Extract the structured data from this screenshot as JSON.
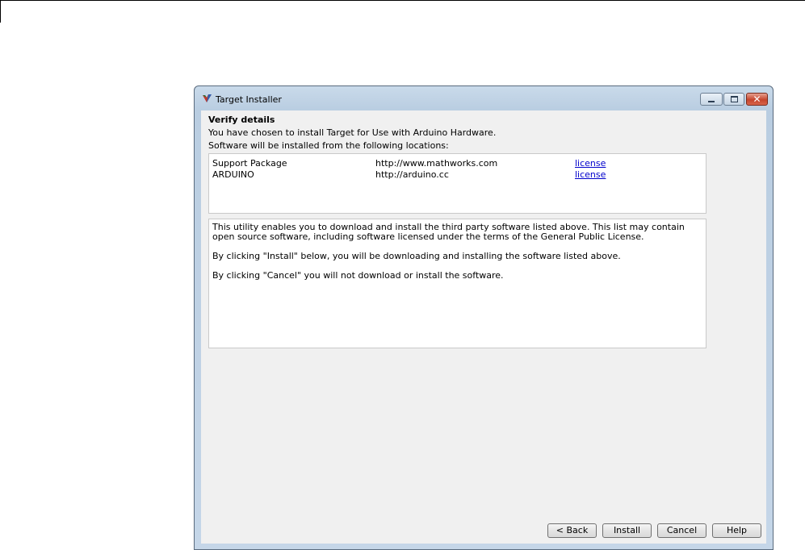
{
  "window": {
    "title": "Target Installer"
  },
  "content": {
    "heading": "Verify details",
    "intro": "You have chosen to install Target for Use with Arduino Hardware.",
    "locations_intro": "Software will be installed from the following locations:",
    "locations": [
      {
        "name": "Support Package",
        "url": "http://www.mathworks.com",
        "link": "license"
      },
      {
        "name": "ARDUINO",
        "url": "http://arduino.cc",
        "link": "license"
      }
    ],
    "notice": [
      "This utility enables you to download and install the third party software listed above. This list may contain open source software, including software licensed under the terms of the General Public License.",
      "By clicking \"Install\" below, you will be downloading and installing the software listed above.",
      "By clicking \"Cancel\" you will not download or install the software."
    ]
  },
  "buttons": {
    "back": "< Back",
    "install": "Install",
    "cancel": "Cancel",
    "help": "Help"
  },
  "icons": {
    "app": "target-installer-icon",
    "minimize": "minimize-icon",
    "maximize": "maximize-icon",
    "close": "close-icon"
  },
  "colors": {
    "link": "#0000cc",
    "close_button": "#c6452d",
    "frame": "#c5d6e8"
  }
}
